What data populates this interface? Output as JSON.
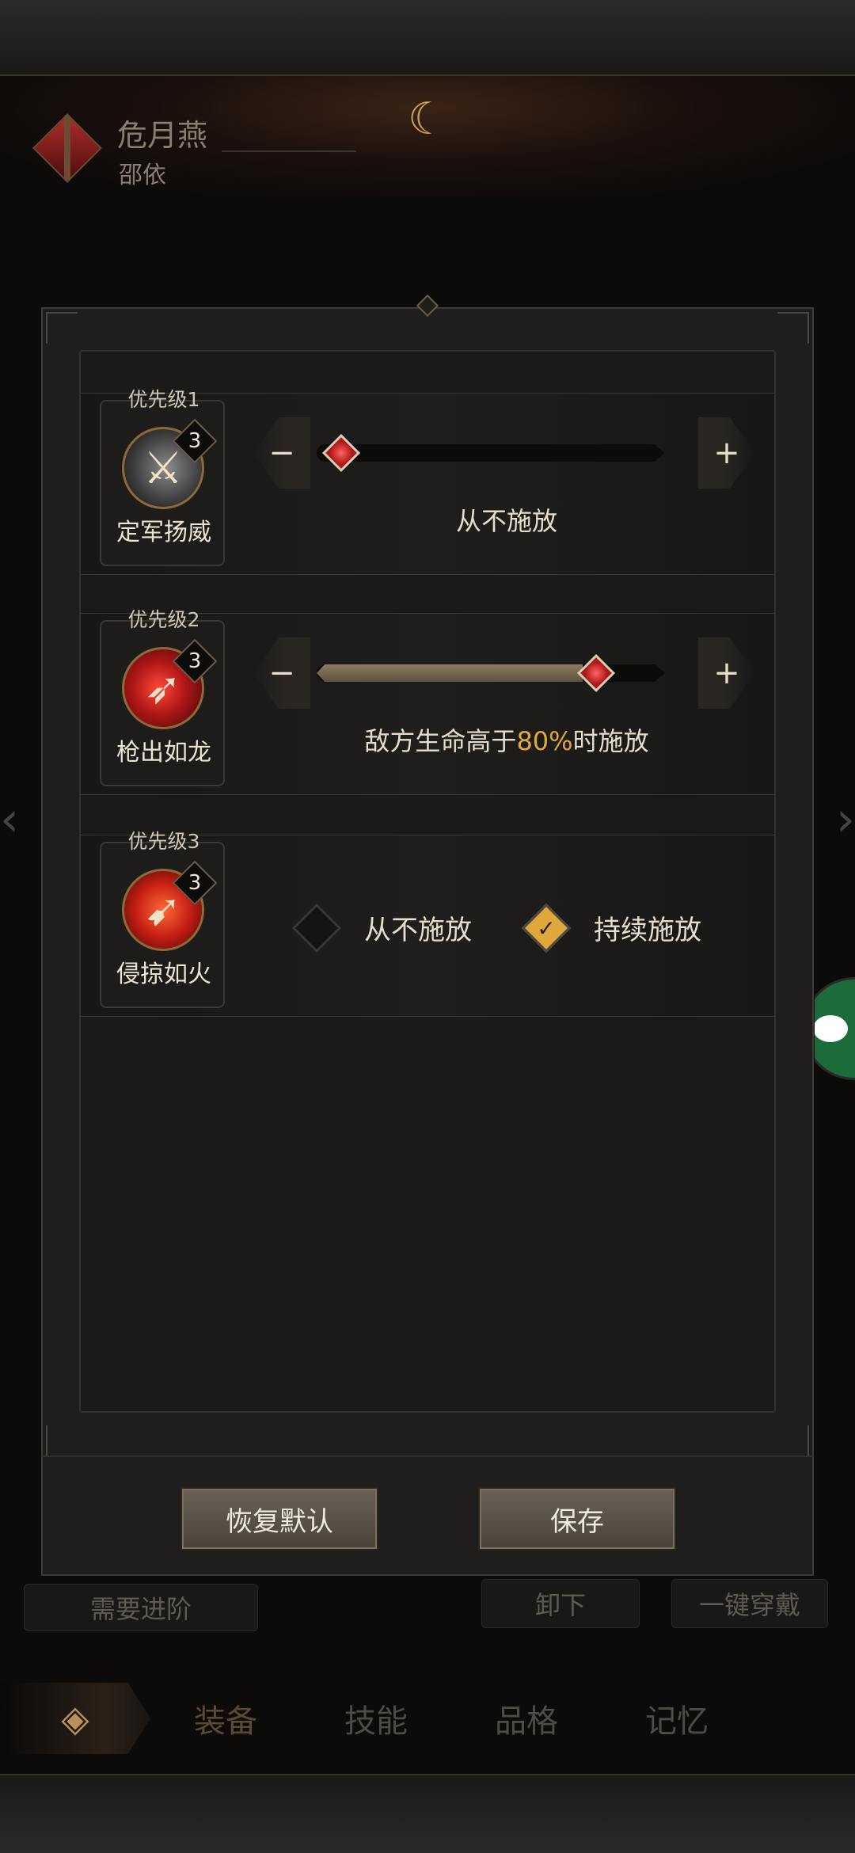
{
  "hero": {
    "name": "危月燕",
    "subtitle": "邵依"
  },
  "modal": {
    "rows": [
      {
        "priority": "优先级1",
        "level": "3",
        "skill_name": "定军扬威",
        "caption": "从不施放",
        "slider_value_percent": 0
      },
      {
        "priority": "优先级2",
        "level": "3",
        "skill_name": "枪出如龙",
        "caption_prefix": "敌方生命高于",
        "caption_highlight": "80%",
        "caption_suffix": "时施放",
        "slider_value_percent": 80
      },
      {
        "priority": "优先级3",
        "level": "3",
        "skill_name": "侵掠如火",
        "options": [
          {
            "label": "从不施放",
            "checked": false
          },
          {
            "label": "持续施放",
            "checked": true
          }
        ]
      }
    ],
    "buttons": {
      "reset": "恢复默认",
      "save": "保存"
    },
    "minus_symbol": "−",
    "plus_symbol": "+"
  },
  "background": {
    "need_advance": "需要进阶",
    "unequip": "卸下",
    "one_key_equip": "一键穿戴",
    "tabs": [
      "装备",
      "技能",
      "品格",
      "记忆"
    ]
  },
  "colors": {
    "highlight": "#e0a83b",
    "slider_handle": "#b01717",
    "panel_bg": "#1f1e1d"
  },
  "icons": {
    "minus": "minus-icon",
    "plus": "plus-icon",
    "checkmark": "checkmark-icon",
    "back": "back-arrow-icon",
    "chat": "wechat-icon"
  }
}
